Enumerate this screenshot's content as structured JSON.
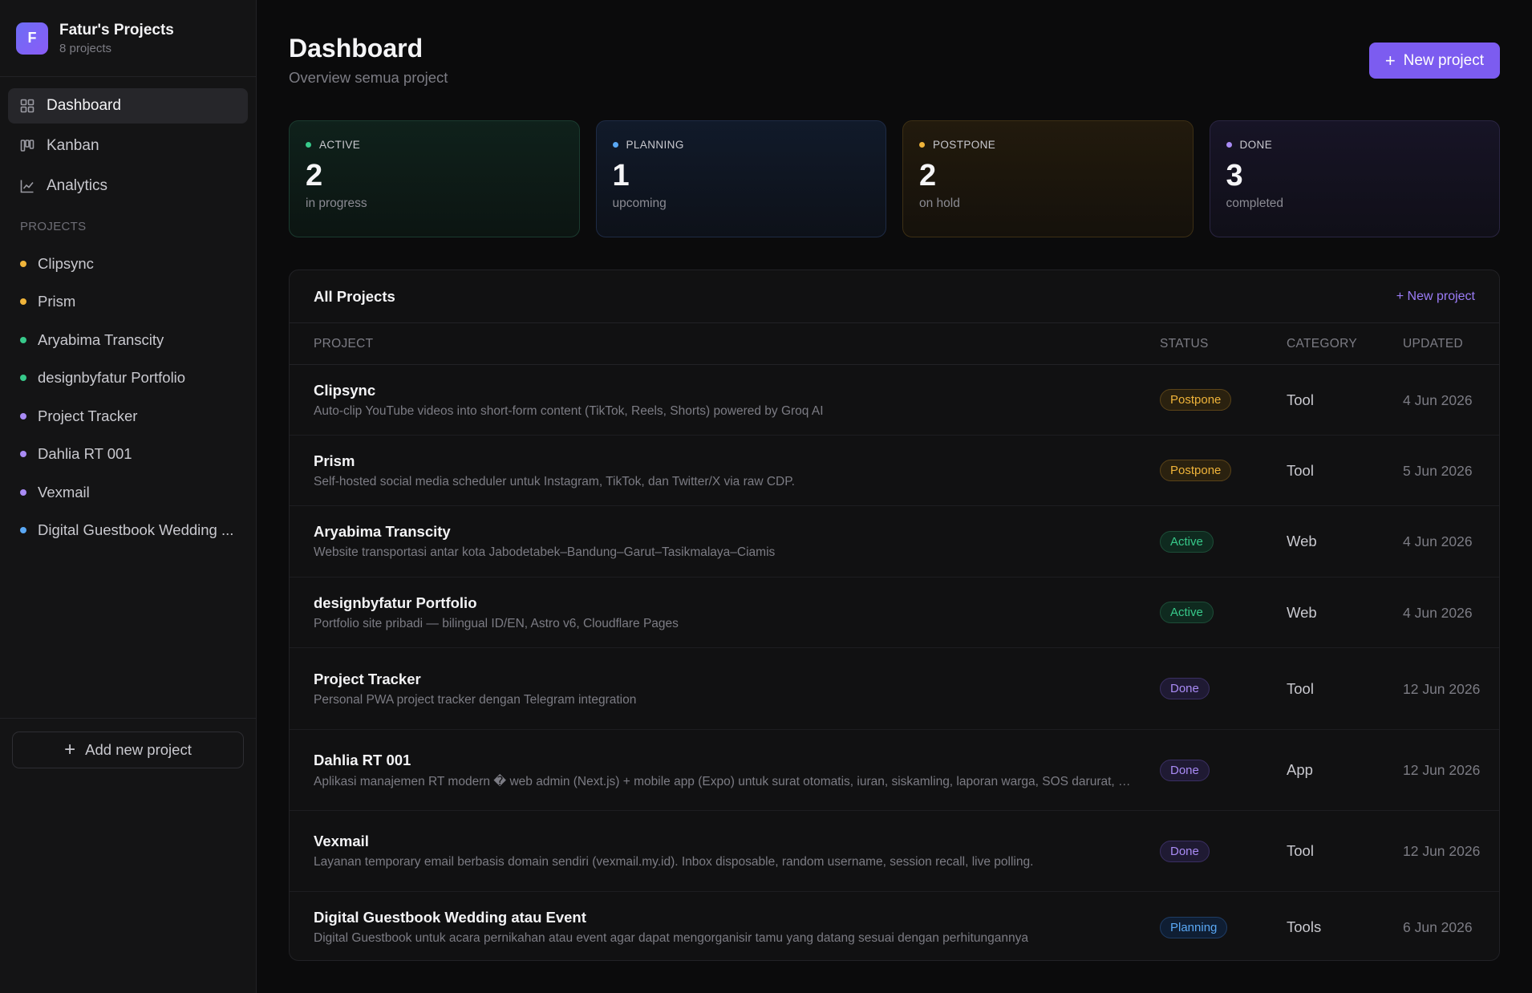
{
  "workspace": {
    "avatar": "F",
    "name": "Fatur's Projects",
    "count": "8 projects"
  },
  "nav": [
    {
      "label": "Dashboard",
      "icon": "grid-icon",
      "active": true
    },
    {
      "label": "Kanban",
      "icon": "kanban-icon",
      "active": false
    },
    {
      "label": "Analytics",
      "icon": "chart-line-icon",
      "active": false
    }
  ],
  "sidebar": {
    "section_label": "PROJECTS",
    "projects": [
      {
        "label": "Clipsync",
        "color": "#f0b43a"
      },
      {
        "label": "Prism",
        "color": "#f0b43a"
      },
      {
        "label": "Aryabima Transcity",
        "color": "#37c98a"
      },
      {
        "label": "designbyfatur Portfolio",
        "color": "#37c98a"
      },
      {
        "label": "Project Tracker",
        "color": "#a98bf5"
      },
      {
        "label": "Dahlia RT 001",
        "color": "#a98bf5"
      },
      {
        "label": "Vexmail",
        "color": "#a98bf5"
      },
      {
        "label": "Digital Guestbook Wedding ...",
        "color": "#5aa8f5"
      }
    ],
    "add_label": "Add new project"
  },
  "header": {
    "title": "Dashboard",
    "subtitle": "Overview semua project",
    "new_button": "New project"
  },
  "stats": [
    {
      "label": "ACTIVE",
      "value": "2",
      "sub": "in progress",
      "color": "#37c98a"
    },
    {
      "label": "PLANNING",
      "value": "1",
      "sub": "upcoming",
      "color": "#5aa8f5"
    },
    {
      "label": "POSTPONE",
      "value": "2",
      "sub": "on hold",
      "color": "#f0b43a"
    },
    {
      "label": "DONE",
      "value": "3",
      "sub": "completed",
      "color": "#a98bf5"
    }
  ],
  "table": {
    "title": "All Projects",
    "new_link": "+ New project",
    "columns": [
      "PROJECT",
      "STATUS",
      "CATEGORY",
      "UPDATED"
    ],
    "rows": [
      {
        "name": "Clipsync",
        "desc": "Auto-clip YouTube videos into short-form content (TikTok, Reels, Shorts) powered by Groq AI",
        "status": "Postpone",
        "category": "Tool",
        "updated": "4 Jun 2026"
      },
      {
        "name": "Prism",
        "desc": "Self-hosted social media scheduler untuk Instagram, TikTok, dan Twitter/X via raw CDP.",
        "status": "Postpone",
        "category": "Tool",
        "updated": "5 Jun 2026"
      },
      {
        "name": "Aryabima Transcity",
        "desc": "Website transportasi antar kota Jabodetabek–Bandung–Garut–Tasikmalaya–Ciamis",
        "status": "Active",
        "category": "Web",
        "updated": "4 Jun 2026"
      },
      {
        "name": "designbyfatur Portfolio",
        "desc": "Portfolio site pribadi — bilingual ID/EN, Astro v6, Cloudflare Pages",
        "status": "Active",
        "category": "Web",
        "updated": "4 Jun 2026"
      },
      {
        "name": "Project Tracker",
        "desc": "Personal PWA project tracker dengan Telegram integration",
        "status": "Done",
        "category": "Tool",
        "updated": "12 Jun 2026"
      },
      {
        "name": "Dahlia RT 001",
        "desc": "Aplikasi manajemen RT modern � web admin (Next.js) + mobile app (Expo) untuk surat otomatis, iuran, siskamling, laporan warga, SOS darurat, dan pengumuman",
        "status": "Done",
        "category": "App",
        "updated": "12 Jun 2026"
      },
      {
        "name": "Vexmail",
        "desc": "Layanan temporary email berbasis domain sendiri (vexmail.my.id). Inbox disposable, random username, session recall, live polling.",
        "status": "Done",
        "category": "Tool",
        "updated": "12 Jun 2026"
      },
      {
        "name": "Digital Guestbook Wedding atau Event",
        "desc": "Digital Guestbook untuk acara pernikahan atau event agar dapat mengorganisir tamu yang datang sesuai dengan perhitungannya",
        "status": "Planning",
        "category": "Tools",
        "updated": "6 Jun 2026"
      }
    ]
  }
}
